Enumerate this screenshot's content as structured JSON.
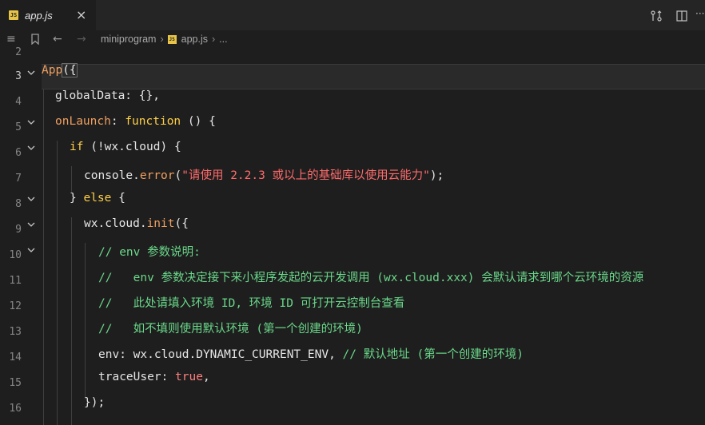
{
  "tab": {
    "badge": "JS",
    "label": "app.js",
    "close": "×"
  },
  "toolbar": {
    "compare_icon": "compare-changes-icon",
    "split_icon": "split-editor-icon",
    "more_label": "···"
  },
  "nav": {
    "menu_icon": "≡",
    "bookmark_icon": "bookmark-icon",
    "back": "←",
    "forward": "→",
    "crumbs": [
      "miniprogram",
      "app.js",
      "..."
    ],
    "crumb_badge": "JS",
    "sep": "›"
  },
  "lines": [
    {
      "n": "2"
    },
    {
      "n": "3"
    },
    {
      "n": "4"
    },
    {
      "n": "5"
    },
    {
      "n": "6"
    },
    {
      "n": "7"
    },
    {
      "n": "8"
    },
    {
      "n": "9"
    },
    {
      "n": "10"
    },
    {
      "n": "11"
    },
    {
      "n": "12"
    },
    {
      "n": "13"
    },
    {
      "n": "14"
    },
    {
      "n": "15"
    },
    {
      "n": "16"
    }
  ],
  "code": {
    "l3_fn": "App",
    "l3_rest": "({",
    "l4": "globalData: {},",
    "l5_name": "onLaunch",
    "l5_colon": ": ",
    "l5_kw": "function",
    "l5_rest": " () {",
    "l6_kw": "if",
    "l6_rest": " (!wx.cloud) {",
    "l7_a": "console.",
    "l7_fn": "error",
    "l7_b": "(",
    "l7_str": "\"请使用 2.2.3 或以上的基础库以使用云能力\"",
    "l7_c": ");",
    "l8_a": "} ",
    "l8_kw": "else",
    "l8_b": " {",
    "l9_a": "wx.cloud.",
    "l9_fn": "init",
    "l9_b": "({",
    "l10": "// env 参数说明:",
    "l11": "//   env 参数决定接下来小程序发起的云开发调用 (wx.cloud.xxx) 会默认请求到哪个云环境的资源",
    "l12": "//   此处请填入环境 ID, 环境 ID 可打开云控制台查看",
    "l13": "//   如不填则使用默认环境 (第一个创建的环境)",
    "l14_a": "env: wx.cloud.DYNAMIC_CURRENT_ENV, ",
    "l14_cm": "// 默认地址 (第一个创建的环境)",
    "l15_a": "traceUser: ",
    "l15_bool": "true",
    "l15_b": ",",
    "l16": "});"
  }
}
